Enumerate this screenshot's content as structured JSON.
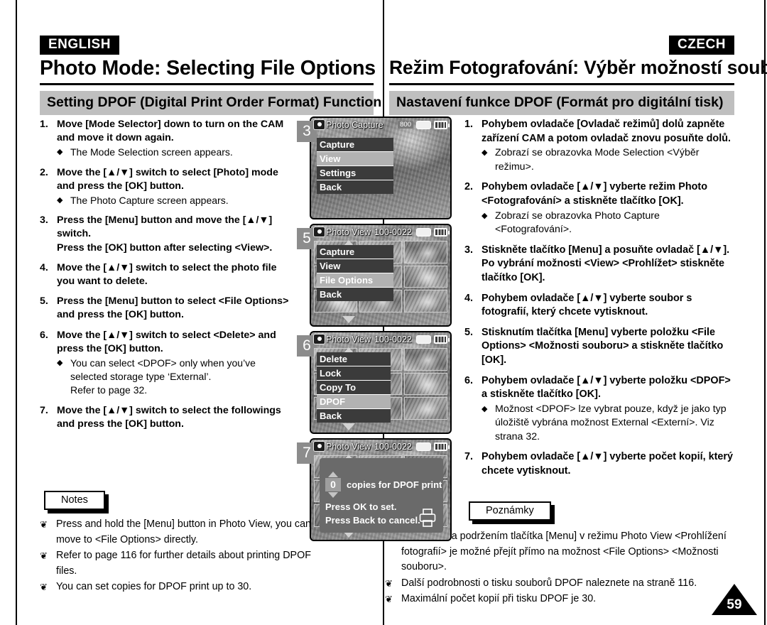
{
  "page": {
    "number": "59",
    "left_language_tag": "ENGLISH",
    "right_language_tag": "CZECH"
  },
  "english": {
    "title": "Photo Mode: Selecting File Options",
    "subtitle": "Setting DPOF (Digital Print Order Format) Function",
    "steps": [
      {
        "num": "1.",
        "text": "Move [Mode Selector] down to turn on the CAM and move it down again.",
        "bullets": [
          "The Mode Selection screen appears."
        ]
      },
      {
        "num": "2.",
        "text": "Move the [▲/▼] switch to select [Photo] mode and press the [OK] button.",
        "bullets": [
          "The Photo Capture screen appears."
        ]
      },
      {
        "num": "3.",
        "text": "Press the [Menu] button and move the [▲/▼] switch.\nPress the [OK] button after selecting <View>.",
        "bullets": []
      },
      {
        "num": "4.",
        "text": "Move the [▲/▼] switch to select the photo file you want to delete.",
        "bullets": []
      },
      {
        "num": "5.",
        "text": "Press the [Menu] button to select <File Options> and press the [OK] button.",
        "bullets": []
      },
      {
        "num": "6.",
        "text": "Move the [▲/▼] switch to select <Delete> and press the [OK] button.",
        "bullets": [
          "You can select <DPOF> only when you’ve selected storage type ‘External’.\nRefer to page 32."
        ]
      },
      {
        "num": "7.",
        "text": "Move the [▲/▼] switch to select the followings and press the [OK] button.",
        "bullets": []
      }
    ],
    "notes_label": "Notes",
    "notes": [
      "Press and hold the [Menu] button in Photo View, you can move to <File Options> directly.",
      "Refer to page 116 for further details about printing DPOF files.",
      "You can set copies for DPOF print up to 30."
    ]
  },
  "czech": {
    "title": "Režim Fotografování: Výběr možností souborů",
    "subtitle": "Nastavení funkce DPOF (Formát pro digitální tisk)",
    "steps": [
      {
        "num": "1.",
        "text": "Pohybem ovladače [Ovladač režimů] dolů zapněte zařízení CAM a potom ovladač znovu posuňte dolů.",
        "bullets": [
          "Zobrazí se obrazovka Mode Selection <Výběr režimu>."
        ]
      },
      {
        "num": "2.",
        "text": "Pohybem ovladače [▲/▼] vyberte režim Photo <Fotografování> a stiskněte tlačítko [OK].",
        "bullets": [
          "Zobrazí se obrazovka Photo Capture <Fotografování>."
        ]
      },
      {
        "num": "3.",
        "text": "Stiskněte tlačítko [Menu] a posuňte ovladač [▲/▼]. Po vybrání možnosti <View> <Prohlížet> stiskněte tlačítko [OK].",
        "bullets": []
      },
      {
        "num": "4.",
        "text": "Pohybem ovladače [▲/▼] vyberte soubor s fotografií, který chcete vytisknout.",
        "bullets": []
      },
      {
        "num": "5.",
        "text": "Stisknutím tlačítka [Menu] vyberte položku <File Options> <Možnosti souboru> a stiskněte tlačítko [OK].",
        "bullets": []
      },
      {
        "num": "6.",
        "text": "Pohybem ovladače [▲/▼] vyberte položku <DPOF> a stiskněte tlačítko [OK].",
        "bullets": [
          "Možnost <DPOF> lze vybrat pouze, když je jako typ úložiště vybrána možnost External <Externí>. Viz strana 32."
        ]
      },
      {
        "num": "7.",
        "text": "Pohybem ovladače [▲/▼] vyberte počet kopií, který chcete vytisknout.",
        "bullets": []
      }
    ],
    "notes_label": "Poznámky",
    "notes": [
      "Stisknutím a podržením tlačítka [Menu] v režimu Photo View <Prohlížení fotografií> je možné přejít přímo na možnost <File Options> <Možnosti souboru>.",
      "Další podrobnosti o tisku souborů DPOF naleznete na straně 116.",
      "Maximální počet kopií při tisku DPOF je 30."
    ]
  },
  "screens": [
    {
      "badge": "3",
      "osd_title": "Photo Capture",
      "osd_file": "",
      "osd_resolution": "800",
      "menu": [
        {
          "label": "Capture",
          "selected": false
        },
        {
          "label": "View",
          "selected": true
        },
        {
          "label": "Settings",
          "selected": false
        },
        {
          "label": "Back",
          "selected": false
        }
      ]
    },
    {
      "badge": "5",
      "osd_title": "Photo View",
      "osd_file": "100-0022",
      "osd_resolution": "",
      "menu": [
        {
          "label": "Capture",
          "selected": false
        },
        {
          "label": "View",
          "selected": false
        },
        {
          "label": "File Options",
          "selected": true
        },
        {
          "label": "Back",
          "selected": false
        }
      ]
    },
    {
      "badge": "6",
      "osd_title": "Photo View",
      "osd_file": "100-0022",
      "osd_resolution": "",
      "menu": [
        {
          "label": "Delete",
          "selected": false
        },
        {
          "label": "Lock",
          "selected": false
        },
        {
          "label": "Copy To",
          "selected": false
        },
        {
          "label": "DPOF",
          "selected": true
        },
        {
          "label": "Back",
          "selected": false
        }
      ]
    },
    {
      "badge": "7",
      "osd_title": "Photo View",
      "osd_file": "100-0022",
      "osd_resolution": "",
      "dialog": {
        "count": "0",
        "label": "copies for DPOF print",
        "line1": "Press OK to set.",
        "line2": "Press Back to cancel."
      }
    }
  ],
  "colors": {
    "subhead_bg": "#bfbfbf",
    "badge_bg": "#8c8c8c",
    "menu_bg": "#3b3b3b",
    "menu_selected_bg": "#b2b2b2",
    "dialog_bg": "#6a6a6a"
  }
}
